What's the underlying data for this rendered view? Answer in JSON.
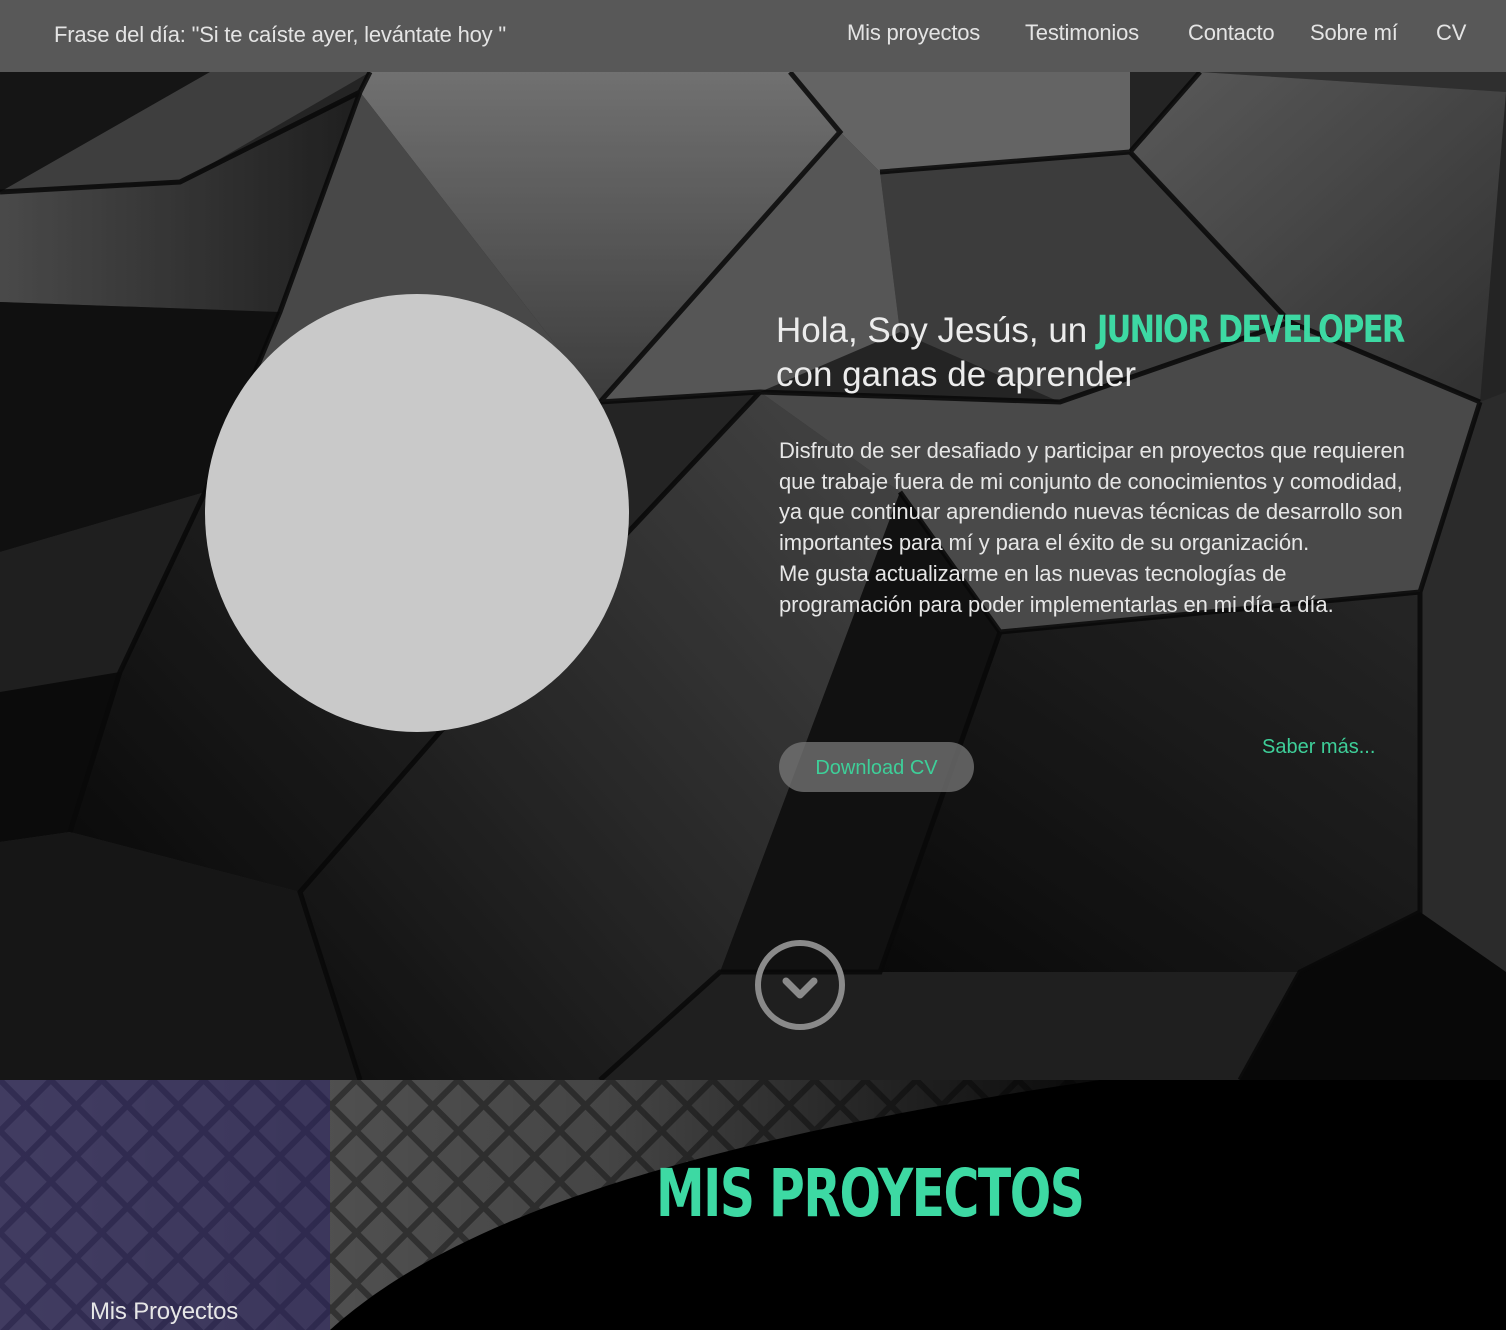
{
  "header": {
    "quote": "Frase del día: \"Si te caíste ayer, levántate hoy \"",
    "nav": {
      "projects": "Mis proyectos",
      "testimonials": "Testimonios",
      "contact": "Contacto",
      "about": "Sobre mí",
      "cv": "CV"
    }
  },
  "hero": {
    "greeting": "Hola, Soy Jesús, un",
    "role": "JUNIOR DEVELOPER",
    "tagline": "con ganas de aprender",
    "paragraph1": "Disfruto de ser desafiado y participar en proyectos que requieren que trabaje fuera de mi conjunto de conocimientos y comodidad, ya que continuar aprendiendo nuevas técnicas de desarrollo son importantes para mí y para el éxito de su organización.",
    "paragraph2": "Me gusta actualizarme en las nuevas tecnologías de programación para poder implementarlas en mi día a día.",
    "download_label": "Download CV",
    "more_label": "Saber más..."
  },
  "projects": {
    "title": "MIS PROYECTOS",
    "label": "Mis Proyectos"
  },
  "colors": {
    "accent": "#3dd9a3",
    "navbar": "#585858",
    "avatar_placeholder": "#c9c9c9"
  },
  "icons": {
    "scroll": "chevron-down-circle-icon"
  }
}
